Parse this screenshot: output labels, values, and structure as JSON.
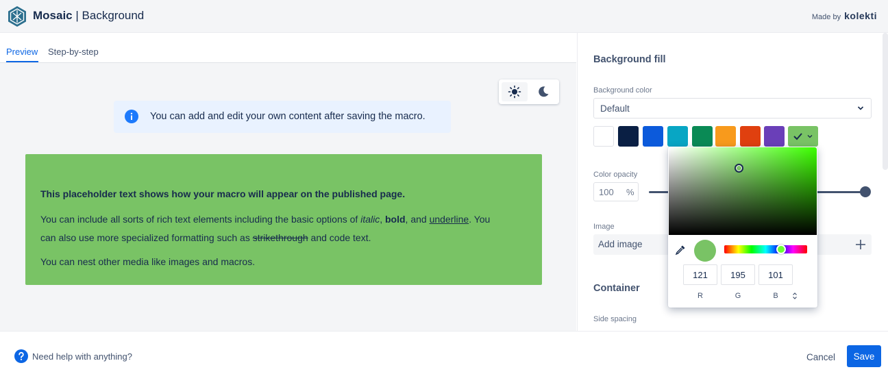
{
  "header": {
    "brand": "Mosaic",
    "separator": "|",
    "page": "Background",
    "made_by": "Made by",
    "vendor": "kolekti"
  },
  "tabs": [
    {
      "label": "Preview",
      "active": true
    },
    {
      "label": "Step-by-step",
      "active": false
    }
  ],
  "preview": {
    "info_banner": "You can add and edit your own content after saving the macro.",
    "placeholder": {
      "heading": "This placeholder text shows how your macro will appear on the published page.",
      "p1_a": "You can include all sorts of rich text elements including the basic options of",
      "p1_italic": "italic",
      "p1_bold": "bold",
      "p1_and": "and",
      "p1_underline": "underline",
      "p1_b": "You",
      "p2_a": "can also use more specialized formatting such as",
      "p2_strike": "strikethrough",
      "p2_b": "and code text.",
      "p3": "You can nest other media like images and macros."
    }
  },
  "settings": {
    "background_fill_title": "Background fill",
    "background_color_label": "Background color",
    "background_color_value": "Default",
    "swatches": [
      {
        "name": "white",
        "color": "#ffffff"
      },
      {
        "name": "navy",
        "color": "#0a1f44"
      },
      {
        "name": "blue",
        "color": "#0c5adb"
      },
      {
        "name": "teal",
        "color": "#08a6c4"
      },
      {
        "name": "green",
        "color": "#0a8a55"
      },
      {
        "name": "orange",
        "color": "#f89a1c"
      },
      {
        "name": "red",
        "color": "#e0400f"
      },
      {
        "name": "purple",
        "color": "#6a3fb8"
      }
    ],
    "selected_swatch_color": "#79c365",
    "color_opacity_label": "Color opacity",
    "color_opacity_value": "100",
    "color_opacity_unit": "%",
    "color_opacity_slider": 1.0,
    "image_label": "Image",
    "add_image_label": "Add image",
    "container_title": "Container",
    "side_spacing_label": "Side spacing"
  },
  "color_picker": {
    "r": "121",
    "g": "195",
    "b": "101",
    "r_label": "R",
    "g_label": "G",
    "b_label": "B",
    "preview_color": "#79c365"
  },
  "footer": {
    "help_text": "Need help with anything?",
    "cancel_label": "Cancel",
    "save_label": "Save"
  },
  "colors": {
    "accent": "#0c66e4",
    "preview_fill": "#79c365",
    "info_bg": "#e9f2ff"
  }
}
